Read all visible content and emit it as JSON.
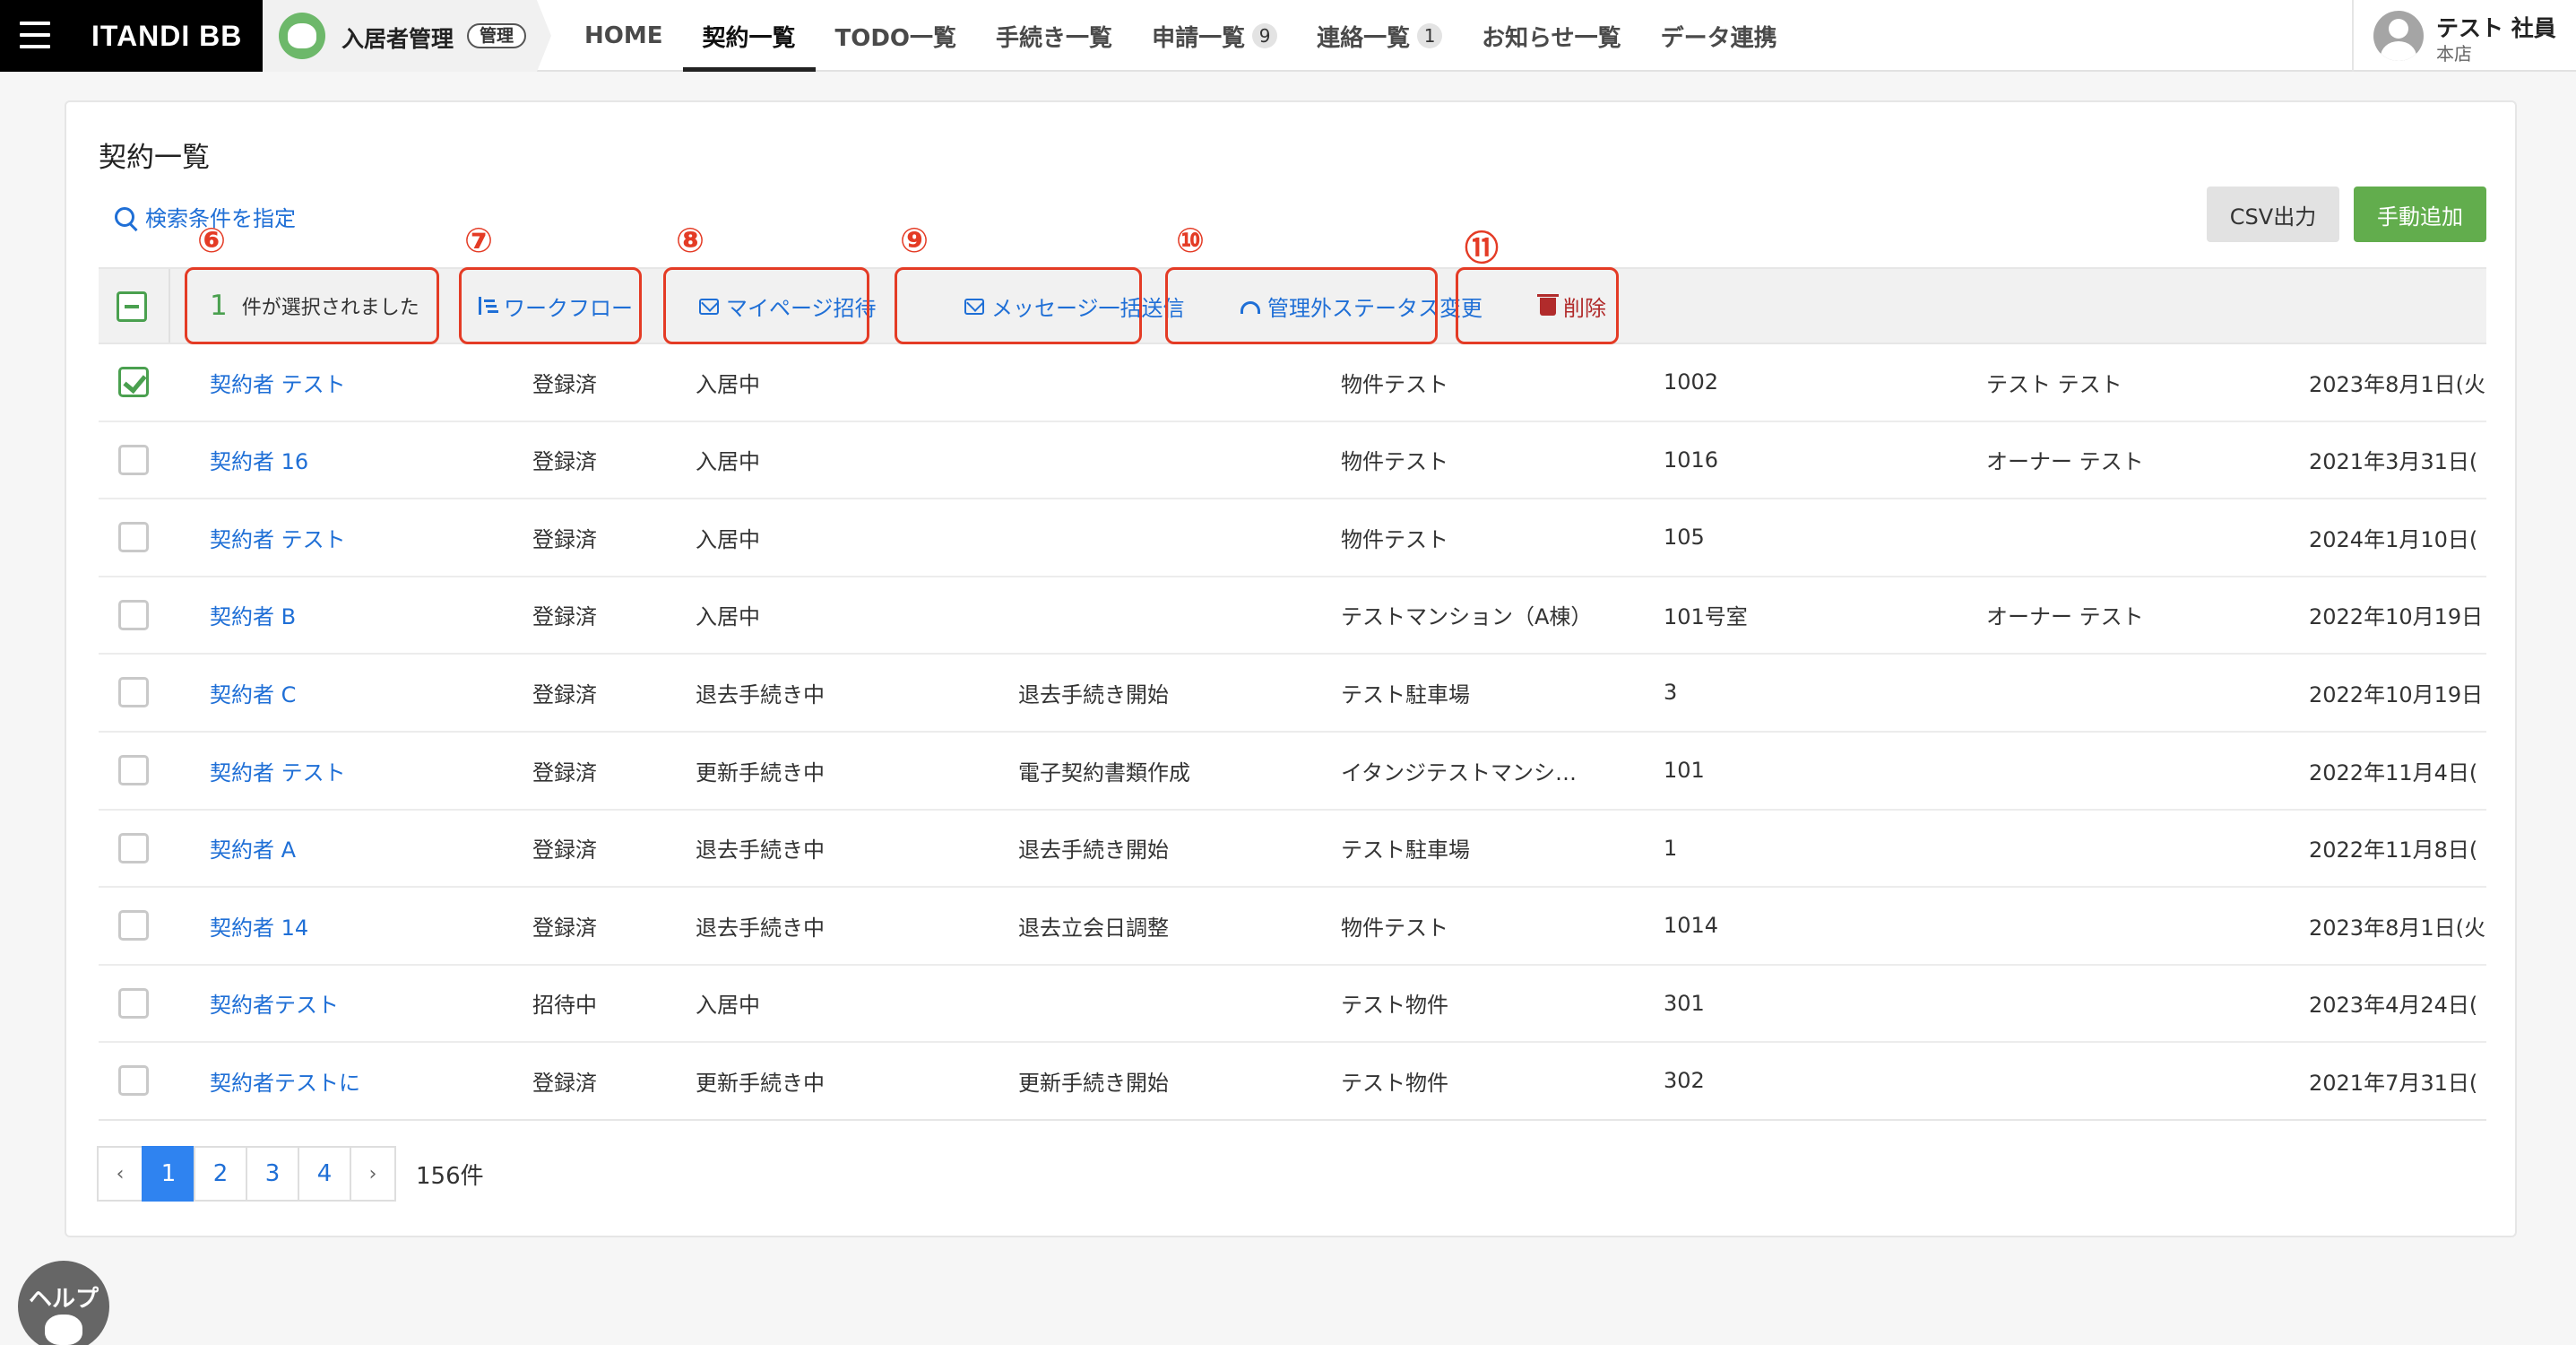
{
  "brand": {
    "name": "ITANDI BB"
  },
  "product": {
    "name": "入居者管理",
    "badge": "管理"
  },
  "nav": {
    "items": [
      {
        "label": "HOME",
        "count": ""
      },
      {
        "label": "契約一覧",
        "count": ""
      },
      {
        "label": "TODO一覧",
        "count": ""
      },
      {
        "label": "手続き一覧",
        "count": ""
      },
      {
        "label": "申請一覧",
        "count": "9"
      },
      {
        "label": "連絡一覧",
        "count": "1"
      },
      {
        "label": "お知らせ一覧",
        "count": ""
      },
      {
        "label": "データ連携",
        "count": ""
      }
    ],
    "active": "契約一覧"
  },
  "user": {
    "name": "テスト 社員",
    "branch": "本店"
  },
  "page": {
    "title": "契約一覧",
    "search_link": "検索条件を指定",
    "csv_button": "CSV出力",
    "add_button": "手動追加"
  },
  "bulk": {
    "selected_count": "1",
    "selected_text": "件が選択されました",
    "workflow": "ワークフロー",
    "mypage_invite": "マイページ招待",
    "bulk_message": "メッセージ一括送信",
    "status_change": "管理外ステータス変更",
    "delete": "削除"
  },
  "markers": [
    "⑥",
    "⑦",
    "⑧",
    "⑨",
    "⑩",
    "⑪"
  ],
  "rows": [
    {
      "checked": true,
      "name": "契約者 テスト",
      "reg": "登録済",
      "status": "入居中",
      "proc": "",
      "property": "物件テスト",
      "room": "1002",
      "owner": "テスト テスト",
      "date": "2023年8月1日(火"
    },
    {
      "checked": false,
      "name": "契約者 16",
      "reg": "登録済",
      "status": "入居中",
      "proc": "",
      "property": "物件テスト",
      "room": "1016",
      "owner": "オーナー テスト",
      "date": "2021年3月31日("
    },
    {
      "checked": false,
      "name": "契約者 テスト",
      "reg": "登録済",
      "status": "入居中",
      "proc": "",
      "property": "物件テスト",
      "room": "105",
      "owner": "",
      "date": "2024年1月10日("
    },
    {
      "checked": false,
      "name": "契約者 B",
      "reg": "登録済",
      "status": "入居中",
      "proc": "",
      "property": "テストマンション（A棟）",
      "room": "101号室",
      "owner": "オーナー テスト",
      "date": "2022年10月19日"
    },
    {
      "checked": false,
      "name": "契約者 C",
      "reg": "登録済",
      "status": "退去手続き中",
      "proc": "退去手続き開始",
      "property": "テスト駐車場",
      "room": "3",
      "owner": "",
      "date": "2022年10月19日"
    },
    {
      "checked": false,
      "name": "契約者 テスト",
      "reg": "登録済",
      "status": "更新手続き中",
      "proc": "電子契約書類作成",
      "property": "イタンジテストマンシ…",
      "room": "101",
      "owner": "",
      "date": "2022年11月4日("
    },
    {
      "checked": false,
      "name": "契約者 A",
      "reg": "登録済",
      "status": "退去手続き中",
      "proc": "退去手続き開始",
      "property": "テスト駐車場",
      "room": "1",
      "owner": "",
      "date": "2022年11月8日("
    },
    {
      "checked": false,
      "name": "契約者 14",
      "reg": "登録済",
      "status": "退去手続き中",
      "proc": "退去立会日調整",
      "property": "物件テスト",
      "room": "1014",
      "owner": "",
      "date": "2023年8月1日(火"
    },
    {
      "checked": false,
      "name": "契約者テスト",
      "reg": "招待中",
      "status": "入居中",
      "proc": "",
      "property": "テスト物件",
      "room": "301",
      "owner": "",
      "date": "2023年4月24日("
    },
    {
      "checked": false,
      "name": "契約者テストに",
      "reg": "登録済",
      "status": "更新手続き中",
      "proc": "更新手続き開始",
      "property": "テスト物件",
      "room": "302",
      "owner": "",
      "date": "2021年7月31日("
    }
  ],
  "pagination": {
    "prev": "‹",
    "pages": [
      "1",
      "2",
      "3",
      "4"
    ],
    "current": "1",
    "next": "›",
    "total": "156件"
  },
  "help": {
    "label": "ヘルプ"
  },
  "colors": {
    "accent_green": "#62ad4d",
    "link_blue": "#1f6fd6",
    "annotation_red": "#e43b25",
    "danger": "#b12b2b"
  }
}
